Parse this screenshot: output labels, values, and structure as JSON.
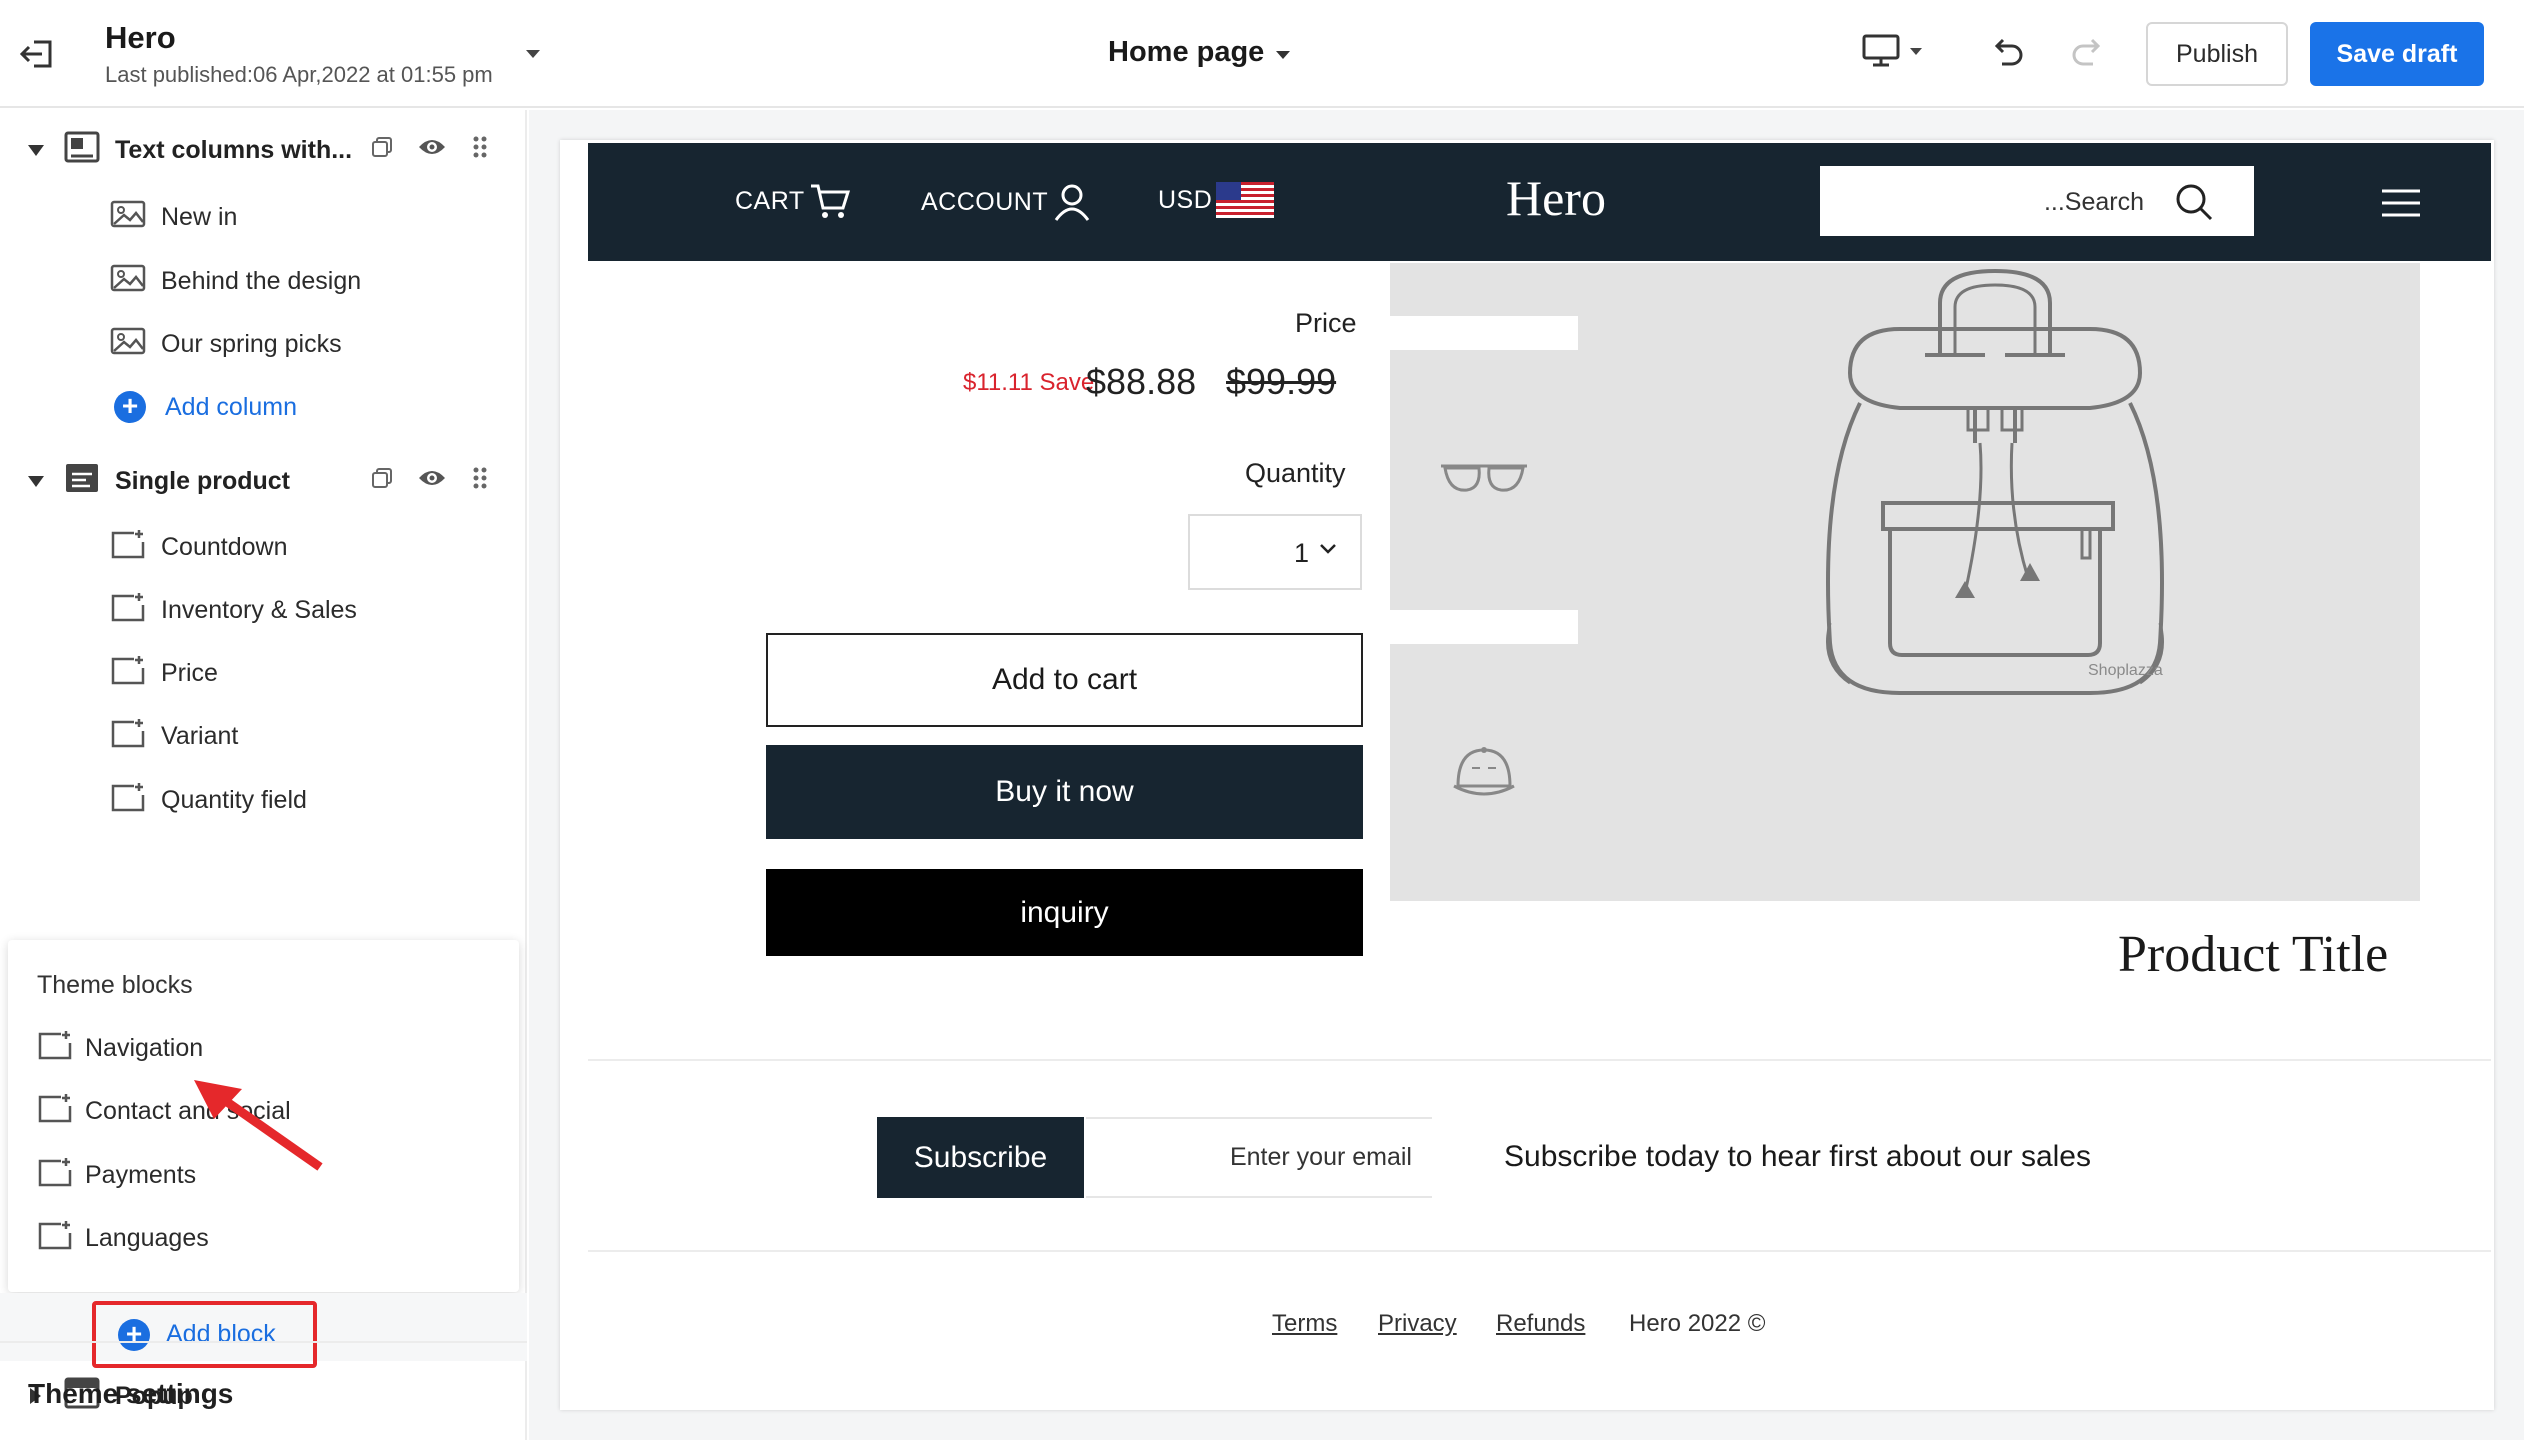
{
  "app": {
    "title": "Hero",
    "last_published": "Last published:06 Apr,2022 at 01:55 pm",
    "page_selector": "Home page"
  },
  "toolbar": {
    "publish_label": "Publish",
    "save_draft_label": "Save draft",
    "icons": [
      "exit-icon",
      "desktop-icon",
      "undo-icon",
      "redo-icon"
    ]
  },
  "sidebar": {
    "sections": [
      {
        "label": "Text columns with...",
        "expanded": true,
        "children": [
          "New in",
          "Behind the design",
          "Our spring picks"
        ],
        "add_label": "Add column"
      },
      {
        "label": "Single product",
        "expanded": true,
        "children": [
          "Countdown",
          "Inventory & Sales",
          "Price",
          "Variant",
          "Quantity field"
        ]
      },
      {
        "label": "Popup",
        "expanded": false
      }
    ],
    "theme_blocks_popup": {
      "title": "Theme blocks",
      "items": [
        "Navigation",
        "Contact and social",
        "Payments",
        "Languages"
      ]
    },
    "add_block_label": "Add block",
    "theme_settings_label": "Theme settings"
  },
  "store": {
    "header": {
      "cart_label": "CART",
      "account_label": "ACCOUNT",
      "currency_label": "USD",
      "logo": "Hero",
      "search_placeholder": "...Search"
    },
    "product": {
      "price_label": "Price",
      "save_text": "$11.11 Save",
      "price_now": "$88.88",
      "price_old": "$99.99",
      "quantity_label": "Quantity",
      "quantity_value": "1",
      "add_to_cart": "Add to cart",
      "buy_now": "Buy it now",
      "inquiry": "inquiry",
      "title": "Product Title",
      "image_watermark": "Shoplazza"
    },
    "newsletter": {
      "button": "Subscribe",
      "placeholder": "Enter your email",
      "text": "Subscribe today to hear first about our sales"
    },
    "footer": {
      "links": [
        "Terms",
        "Privacy",
        "Refunds"
      ],
      "copyright": "Hero 2022 ©"
    }
  },
  "colors": {
    "accent": "#1a73e8",
    "store_dark": "#172530",
    "sale_red": "#d9232d",
    "highlight_red": "#e5282b"
  }
}
